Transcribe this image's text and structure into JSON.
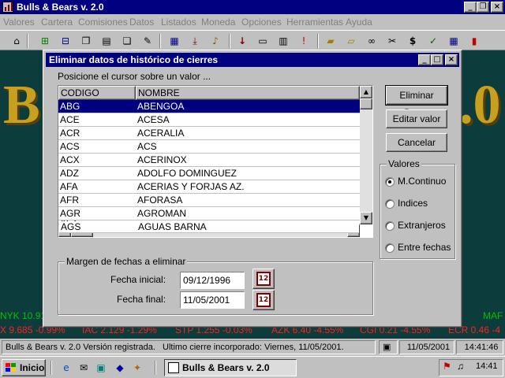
{
  "app": {
    "title": "Bulls & Bears v. 2.0",
    "menu": [
      "Valores",
      "Cartera",
      "Comisiones",
      "Datos",
      "Listados",
      "Moneda",
      "Opciones",
      "Herramientas",
      "Ayuda"
    ]
  },
  "background": {
    "logo_left": "B",
    "logo_right": ".0",
    "ticker_left_1": "NYK 10.91",
    "ticker_right_1": "MAF",
    "ticker_left_2": "X 9.685 -0.99%",
    "ticker_2b": "IAC 2.129 -1.29%",
    "ticker_2c": "STP 1.255 -0.03%",
    "ticker_2d": "AZK 6.40 -4.55%",
    "ticker_2e": "CGI 0.21 -4.55%",
    "ticker_2f": "ECR 0.46 -4"
  },
  "dialog": {
    "title": "Eliminar datos de histórico de cierres",
    "instruction": "Posicione el cursor sobre un valor ...",
    "columns": {
      "code": "CODIGO",
      "name": "NOMBRE"
    },
    "rows": [
      {
        "code": "ABG",
        "name": "ABENGOA"
      },
      {
        "code": "ACE",
        "name": "ACESA"
      },
      {
        "code": "ACR",
        "name": "ACERALIA"
      },
      {
        "code": "ACS",
        "name": "ACS"
      },
      {
        "code": "ACX",
        "name": "ACERINOX"
      },
      {
        "code": "ADZ",
        "name": "ADOLFO DOMINGUEZ"
      },
      {
        "code": "AFA",
        "name": "ACERIAS Y FORJAS AZ."
      },
      {
        "code": "AFR",
        "name": "AFORASA"
      },
      {
        "code": "AGR",
        "name": "AGROMAN"
      },
      {
        "code": "AGS",
        "name": "AGUAS BARNA"
      }
    ],
    "buttons": {
      "delete": "Eliminar Datos",
      "edit": "Editar valor",
      "cancel": "Cancelar"
    },
    "values_group": {
      "title": "Valores",
      "options": [
        "M.Continuo",
        "Indices",
        "Extranjeros",
        "Entre fechas"
      ],
      "selected": "M.Continuo"
    },
    "dates_group": {
      "title": "Margen de fechas a eliminar",
      "start_label": "Fecha inicial:",
      "start_value": "09/12/1996",
      "end_label": "Fecha final:",
      "end_value": "11/05/2001",
      "calendar_glyph": "12"
    }
  },
  "statusbar": {
    "message": "Bulls & Bears v. 2.0  Versión registrada.",
    "last_close": "Ultimo cierre incorporado: Viernes, 11/05/2001.",
    "date": "11/05/2001",
    "time": "14:41:46"
  },
  "taskbar": {
    "start": "Inicio",
    "task": "Bulls & Bears v. 2.0",
    "clock": "14:41"
  },
  "colors": {
    "titlebar": "#000080",
    "selection": "#000080",
    "ticker_green": "#00c000",
    "ticker_red": "#ff2020",
    "stage": "#0c3c3c"
  }
}
